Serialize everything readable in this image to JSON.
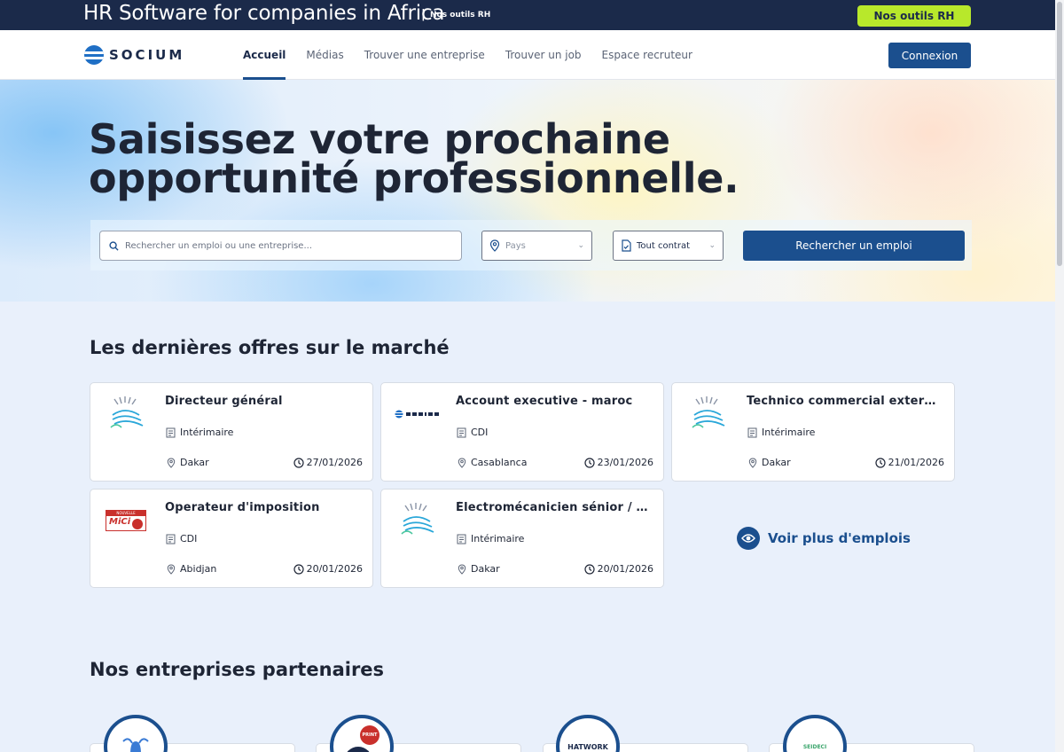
{
  "topbar": {
    "title": "HR Software for companies in Africa",
    "separator": "|",
    "small_label": "Nos outils RH",
    "button_label": "Nos outils RH"
  },
  "nav": {
    "logo_text": "SOCIUM",
    "links": [
      "Accueil",
      "Médias",
      "Trouver une entreprise",
      "Trouver un job",
      "Espace recruteur"
    ],
    "active_link": "Accueil",
    "login_label": "Connexion"
  },
  "hero": {
    "title_line1": "Saisissez votre prochaine",
    "title_line2": "opportunité professionnelle."
  },
  "search": {
    "placeholder": "Rechercher un emploi ou une entreprise...",
    "country_placeholder": "Pays",
    "contract_value": "Tout contrat",
    "button_label": "Rechercher un emploi"
  },
  "jobs": {
    "section_title": "Les dernières offres sur le marché",
    "items": [
      {
        "title": "Directeur général",
        "contract": "Intérimaire",
        "city": "Dakar",
        "date": "27/01/2026",
        "logo": "fan-logo"
      },
      {
        "title": "Account executive - maroc",
        "contract": "CDI",
        "city": "Casablanca",
        "date": "23/01/2026",
        "logo": "socium-logo"
      },
      {
        "title": "Technico commercial externe – …",
        "contract": "Intérimaire",
        "city": "Dakar",
        "date": "21/01/2026",
        "logo": "fan-logo"
      },
      {
        "title": "Operateur d'imposition",
        "contract": "CDI",
        "city": "Abidjan",
        "date": "20/01/2026",
        "logo": "mici-logo"
      },
      {
        "title": "Électromécanicien sénior / cha…",
        "contract": "Intérimaire",
        "city": "Dakar",
        "date": "20/01/2026",
        "logo": "fan-logo"
      }
    ],
    "more_label": "Voir plus d'emplois",
    "mici_small": "NOUVELLE",
    "mici_big": "MiCi"
  },
  "partners": {
    "section_title": "Nos entreprises partenaires",
    "logos": [
      {
        "name": "bell-logo",
        "text": ""
      },
      {
        "name": "print-logo",
        "text": "PRINT"
      },
      {
        "name": "hatwork-logo",
        "text": "HATWORK"
      },
      {
        "name": "seideci-logo",
        "text": "SEIDECI"
      }
    ]
  },
  "colors": {
    "primary": "#1b4f8e",
    "topbar_bg": "#1b2a4a",
    "accent_green": "#b8e82b",
    "page_bg": "#e9f0fb"
  }
}
